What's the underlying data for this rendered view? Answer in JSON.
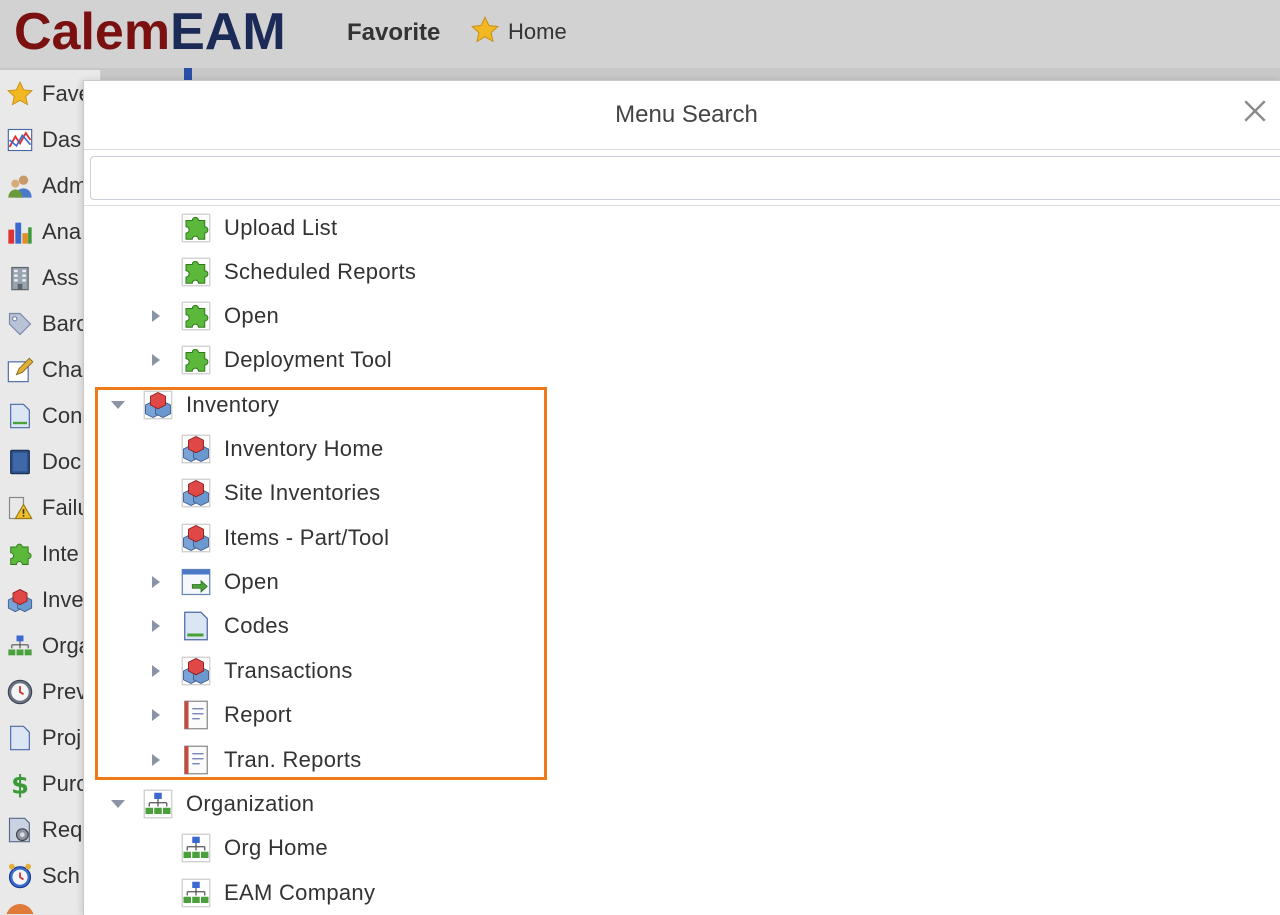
{
  "header": {
    "logo_part1": "Calem",
    "logo_part2": "EAM",
    "favorite_label": "Favorite",
    "home_label": "Home"
  },
  "sidebar": {
    "items": [
      {
        "label": "Fave",
        "icon": "star-icon"
      },
      {
        "label": "Das",
        "icon": "dashboard-chart-icon"
      },
      {
        "label": "Adm",
        "icon": "users-icon"
      },
      {
        "label": "Ana",
        "icon": "bar-chart-icon"
      },
      {
        "label": "Ass",
        "icon": "building-icon"
      },
      {
        "label": "Barc",
        "icon": "tag-icon"
      },
      {
        "label": "Cha",
        "icon": "edit-pencil-icon"
      },
      {
        "label": "Con",
        "icon": "document-icon"
      },
      {
        "label": "Doc",
        "icon": "book-icon"
      },
      {
        "label": "Failu",
        "icon": "warning-icon"
      },
      {
        "label": "Inte",
        "icon": "puzzle-icon"
      },
      {
        "label": "Inve",
        "icon": "inventory-cubes-icon"
      },
      {
        "label": "Orga",
        "icon": "org-chart-icon"
      },
      {
        "label": "Prev",
        "icon": "clock-icon"
      },
      {
        "label": "Proj",
        "icon": "document-icon"
      },
      {
        "label": "Purc",
        "icon": "dollar-icon"
      },
      {
        "label": "Req",
        "icon": "request-gear-icon"
      },
      {
        "label": "Sch",
        "icon": "alarm-clock-icon"
      }
    ]
  },
  "dialog": {
    "title": "Menu Search",
    "search_value": "",
    "search_placeholder": ""
  },
  "tree": {
    "rows": [
      {
        "label": "Upload List",
        "icon": "puzzle-icon",
        "level": 2,
        "arrow": "none"
      },
      {
        "label": "Scheduled Reports",
        "icon": "puzzle-icon",
        "level": 2,
        "arrow": "none"
      },
      {
        "label": "Open",
        "icon": "puzzle-icon",
        "level": 2,
        "arrow": "collapsed"
      },
      {
        "label": "Deployment Tool",
        "icon": "puzzle-icon",
        "level": 2,
        "arrow": "collapsed"
      },
      {
        "label": "Inventory",
        "icon": "inventory-cubes-icon",
        "level": 1,
        "arrow": "expanded"
      },
      {
        "label": "Inventory Home",
        "icon": "inventory-cubes-icon",
        "level": 2,
        "arrow": "none"
      },
      {
        "label": "Site Inventories",
        "icon": "inventory-cubes-icon",
        "level": 2,
        "arrow": "none"
      },
      {
        "label": "Items - Part/Tool",
        "icon": "inventory-cubes-icon",
        "level": 2,
        "arrow": "none"
      },
      {
        "label": "Open",
        "icon": "open-window-icon",
        "level": 2,
        "arrow": "collapsed"
      },
      {
        "label": "Codes",
        "icon": "document-icon",
        "level": 2,
        "arrow": "collapsed"
      },
      {
        "label": "Transactions",
        "icon": "inventory-cubes-icon",
        "level": 2,
        "arrow": "collapsed"
      },
      {
        "label": "Report",
        "icon": "report-icon",
        "level": 2,
        "arrow": "collapsed"
      },
      {
        "label": "Tran. Reports",
        "icon": "report-icon",
        "level": 2,
        "arrow": "collapsed"
      },
      {
        "label": "Organization",
        "icon": "org-chart-icon",
        "level": 1,
        "arrow": "expanded"
      },
      {
        "label": "Org Home",
        "icon": "org-chart-icon",
        "level": 2,
        "arrow": "none"
      },
      {
        "label": "EAM Company",
        "icon": "org-chart-icon",
        "level": 2,
        "arrow": "none"
      }
    ]
  },
  "colors": {
    "highlight": "#f07a1a",
    "logo_red": "#7a1010",
    "logo_blue": "#1b2a56"
  }
}
